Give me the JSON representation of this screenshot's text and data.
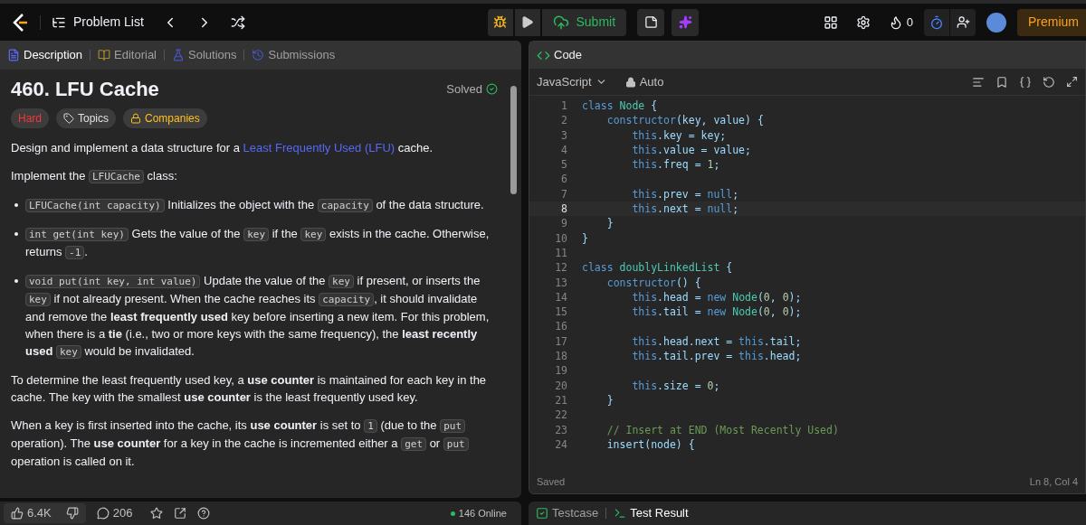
{
  "topbar": {
    "nav_title": "Problem List",
    "submit": "Submit",
    "streak": "0",
    "premium": "Premium"
  },
  "left_tabs": [
    {
      "label": "Description",
      "selected": true,
      "kind": "description"
    },
    {
      "label": "Editorial",
      "selected": false,
      "kind": "editorial"
    },
    {
      "label": "Solutions",
      "selected": false,
      "kind": "solutions"
    },
    {
      "label": "Submissions",
      "selected": false,
      "kind": "submissions"
    }
  ],
  "problem": {
    "title": "460. LFU Cache",
    "status": "Solved",
    "tags": [
      {
        "label": "Hard",
        "kind": "difficulty"
      },
      {
        "label": "Topics",
        "kind": "topics"
      },
      {
        "label": "Companies",
        "kind": "companies"
      }
    ]
  },
  "description": [
    {
      "kind": "para",
      "segments": [
        {
          "kind": "text",
          "text": "Design and implement a data structure for a "
        },
        {
          "kind": "link",
          "text": "Least Frequently Used (LFU)"
        },
        {
          "kind": "text",
          "text": " cache."
        }
      ]
    },
    {
      "kind": "para",
      "segments": [
        {
          "kind": "text",
          "text": "Implement the "
        },
        {
          "kind": "code",
          "text": "LFUCache"
        },
        {
          "kind": "text",
          "text": " class:"
        }
      ]
    },
    {
      "kind": "bullet",
      "segments": [
        {
          "kind": "code",
          "text": "LFUCache(int capacity)"
        },
        {
          "kind": "text",
          "text": " Initializes the object with the "
        },
        {
          "kind": "code",
          "text": "capacity"
        },
        {
          "kind": "text",
          "text": " of the data structure."
        }
      ]
    },
    {
      "kind": "bullet",
      "segments": [
        {
          "kind": "code",
          "text": "int get(int key)"
        },
        {
          "kind": "text",
          "text": " Gets the value of the "
        },
        {
          "kind": "code",
          "text": "key"
        },
        {
          "kind": "text",
          "text": " if the "
        },
        {
          "kind": "code",
          "text": "key"
        },
        {
          "kind": "text",
          "text": " exists in the cache. Otherwise, returns "
        },
        {
          "kind": "code",
          "text": "-1"
        },
        {
          "kind": "text",
          "text": "."
        }
      ]
    },
    {
      "kind": "bullet",
      "segments": [
        {
          "kind": "code",
          "text": "void put(int key, int value)"
        },
        {
          "kind": "text",
          "text": " Update the value of the "
        },
        {
          "kind": "code",
          "text": "key"
        },
        {
          "kind": "text",
          "text": " if present, or inserts the "
        },
        {
          "kind": "code",
          "text": "key"
        },
        {
          "kind": "text",
          "text": " if not already present. When the cache reaches its "
        },
        {
          "kind": "code",
          "text": "capacity"
        },
        {
          "kind": "text",
          "text": ", it should invalidate and remove the **least frequently used** key before inserting a new item. For this problem, when there is a **tie** (i.e., two or more keys with the same frequency), the **least recently used** "
        },
        {
          "kind": "code",
          "text": "key"
        },
        {
          "kind": "text",
          "text": " would be invalidated."
        }
      ]
    },
    {
      "kind": "para",
      "segments": [
        {
          "kind": "text",
          "text": "To determine the least frequently used key, a **use counter** is maintained for each key in the cache. The key with the smallest **use counter** is the least frequently used key."
        }
      ]
    },
    {
      "kind": "para",
      "segments": [
        {
          "kind": "text",
          "text": "When a key is first inserted into the cache, its **use counter** is set to "
        },
        {
          "kind": "code",
          "text": "1"
        },
        {
          "kind": "text",
          "text": " (due to the "
        },
        {
          "kind": "code",
          "text": "put"
        },
        {
          "kind": "text",
          "text": " operation). The **use counter** for a key in the cache is incremented either a "
        },
        {
          "kind": "code",
          "text": "get"
        },
        {
          "kind": "text",
          "text": " or "
        },
        {
          "kind": "code",
          "text": "put"
        },
        {
          "kind": "text",
          "text": " operation is called on it."
        }
      ]
    }
  ],
  "left_footer": {
    "likes": "6.4K",
    "comments": "206",
    "online": "146 Online"
  },
  "code_panel": {
    "title": "Code",
    "language": "JavaScript",
    "mode": "Auto",
    "status": "Saved",
    "cursor": "Ln 8, Col 4"
  },
  "code_lines": [
    {
      "number": "1",
      "text": "class Node {",
      "active": false
    },
    {
      "number": "2",
      "text": "    constructor(key, value) {",
      "active": false
    },
    {
      "number": "3",
      "text": "        this.key = key;",
      "active": false
    },
    {
      "number": "4",
      "text": "        this.value = value;",
      "active": false
    },
    {
      "number": "5",
      "text": "        this.freq = 1;",
      "active": false
    },
    {
      "number": "6",
      "active": false
    },
    {
      "number": "7",
      "text": "        this.prev = null;",
      "active": false
    },
    {
      "number": "8",
      "text": "        this.next = null;",
      "active": true
    },
    {
      "number": "9",
      "text": "    }",
      "active": false
    },
    {
      "number": "10",
      "text": "}",
      "active": false
    },
    {
      "number": "11",
      "active": false
    },
    {
      "number": "12",
      "text": "class doublyLinkedList {",
      "active": false
    },
    {
      "number": "13",
      "text": "    constructor() {",
      "active": false
    },
    {
      "number": "14",
      "text": "        this.head = new Node(0, 0);",
      "active": false
    },
    {
      "number": "15",
      "text": "        this.tail = new Node(0, 0);",
      "active": false
    },
    {
      "number": "16",
      "active": false
    },
    {
      "number": "17",
      "text": "        this.head.next = this.tail;",
      "active": false
    },
    {
      "number": "18",
      "text": "        this.tail.prev = this.head;",
      "active": false
    },
    {
      "number": "19",
      "active": false
    },
    {
      "number": "20",
      "text": "        this.size = 0;",
      "active": false
    },
    {
      "number": "21",
      "text": "    }",
      "active": false
    },
    {
      "number": "22",
      "active": false
    },
    {
      "number": "23",
      "text": "    // Insert at END (Most Recently Used)",
      "active": false
    },
    {
      "number": "24",
      "text": "    insert(node) {",
      "active": false
    }
  ],
  "bottom_tabs": [
    {
      "label": "Testcase",
      "selected": false,
      "kind": "testcase"
    },
    {
      "label": "Test Result",
      "selected": true,
      "kind": "result"
    }
  ]
}
